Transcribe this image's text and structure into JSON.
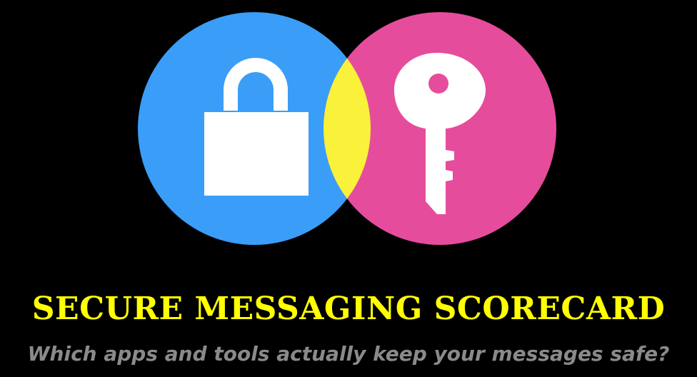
{
  "header": {
    "title": "SECURE MESSAGING SCORECARD",
    "subtitle": "Which apps and tools actually keep your messages safe?"
  },
  "logo": {
    "left_circle_icon": "padlock-icon",
    "right_circle_icon": "key-icon",
    "colors": {
      "left_circle": "#3a9df8",
      "right_circle": "#e64c9c",
      "overlap": "#f9f13a",
      "icons": "#ffffff",
      "background": "#000000",
      "title": "#ffff00",
      "subtitle": "#8a8a8a"
    }
  }
}
